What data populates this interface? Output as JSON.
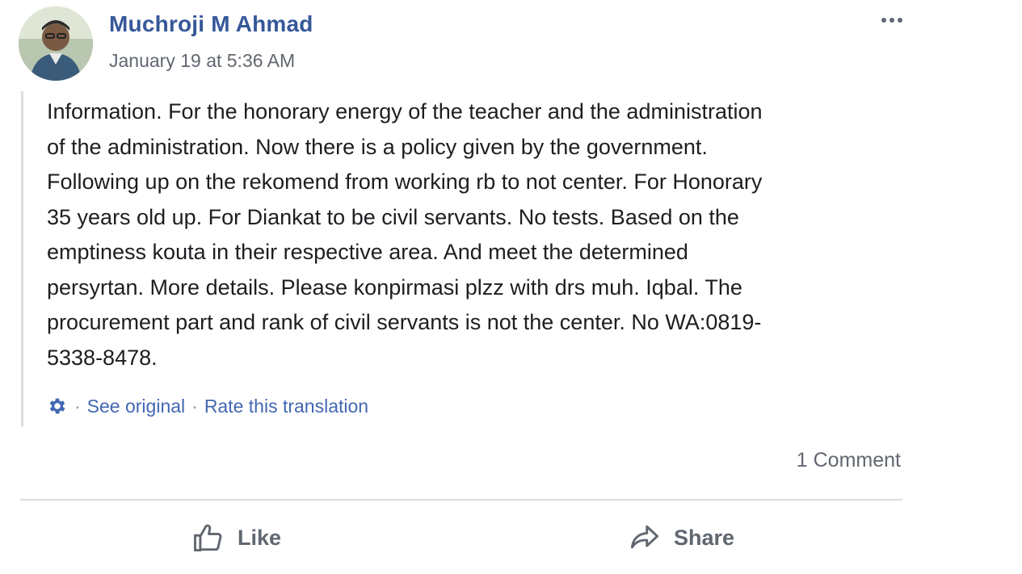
{
  "post": {
    "author_name": "Muchroji M Ahmad",
    "timestamp": "January 19 at 5:36 AM",
    "more_options_icon": "more-horizontal-icon",
    "text": "Information. For the honorary energy of the teacher and the administration of the administration. Now there is a policy given by the government. Following up on the rekomend from working rb to not center. For Honorary 35 years old up. For Diankat to be civil servants. No tests. Based on the emptiness kouta in their respective area. And meet the determined persyrtan. More details. Please konpirmasi plzz with drs muh. Iqbal. The procurement part and rank of civil servants is not the center. No WA:0819-5338-8478.",
    "text_lines": [
      "Information. For the honorary energy of the teacher and the administration",
      "of the administration. Now there is a policy given by the government.",
      "Following up on the rekomend from working rb to not center. For Honorary",
      "35 years old up. For Diankat to be civil servants. No tests. Based on the",
      "emptiness kouta in their respective area. And meet the determined",
      "persyrtan. More details. Please konpirmasi plzz with drs muh. Iqbal. The",
      "procurement part and rank of civil servants is not the center. No WA:0819-",
      "5338-8478."
    ]
  },
  "translation": {
    "settings_icon": "gear-icon",
    "separator": "·",
    "see_original_label": "See original",
    "rate_translation_label": "Rate this translation"
  },
  "stats": {
    "comment_count_label": "1 Comment"
  },
  "actions": {
    "like_label": "Like",
    "like_icon": "thumbs-up-icon",
    "share_label": "Share",
    "share_icon": "share-arrow-icon"
  },
  "colors": {
    "author_link": "#365899",
    "translation_link": "#4267b2",
    "secondary_text": "#616770",
    "body_text": "#1c1e21",
    "divider": "#dadde1"
  }
}
